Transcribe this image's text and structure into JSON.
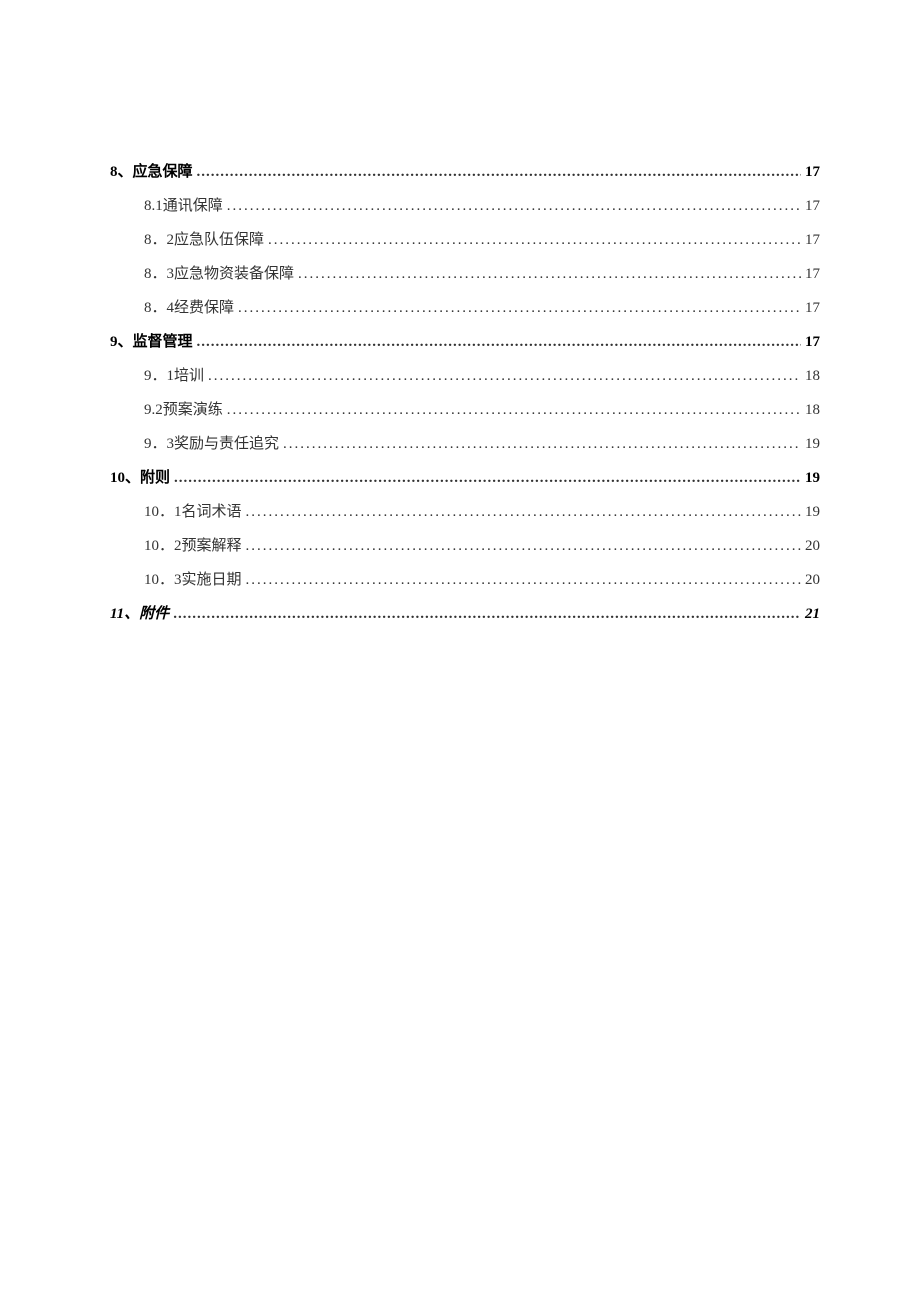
{
  "toc": {
    "entries": [
      {
        "level": 1,
        "label": "8、应急保障",
        "page": "17",
        "italic": false
      },
      {
        "level": 2,
        "label": "8.1通讯保障",
        "page": "17",
        "italic": false
      },
      {
        "level": 2,
        "label": "8．2应急队伍保障",
        "page": "17",
        "italic": false
      },
      {
        "level": 2,
        "label": "8．3应急物资装备保障",
        "page": "17",
        "italic": false
      },
      {
        "level": 2,
        "label": "8．4经费保障",
        "page": "17",
        "italic": false
      },
      {
        "level": 1,
        "label": "9、监督管理",
        "page": "17",
        "italic": false
      },
      {
        "level": 2,
        "label": "9．1培训",
        "page": "18",
        "italic": false
      },
      {
        "level": 2,
        "label": "9.2预案演练",
        "page": "18",
        "italic": false
      },
      {
        "level": 2,
        "label": "9．3奖励与责任追究",
        "page": "19",
        "italic": false
      },
      {
        "level": 1,
        "label": "10、附则",
        "page": "19",
        "italic": false
      },
      {
        "level": 2,
        "label": "10．1名词术语",
        "page": "19",
        "italic": false
      },
      {
        "level": 2,
        "label": "10．2预案解释",
        "page": "20",
        "italic": false
      },
      {
        "level": 2,
        "label": "10．3实施日期",
        "page": "20",
        "italic": false
      },
      {
        "level": 1,
        "label": "11、附件",
        "page": "21",
        "italic": true
      }
    ]
  }
}
